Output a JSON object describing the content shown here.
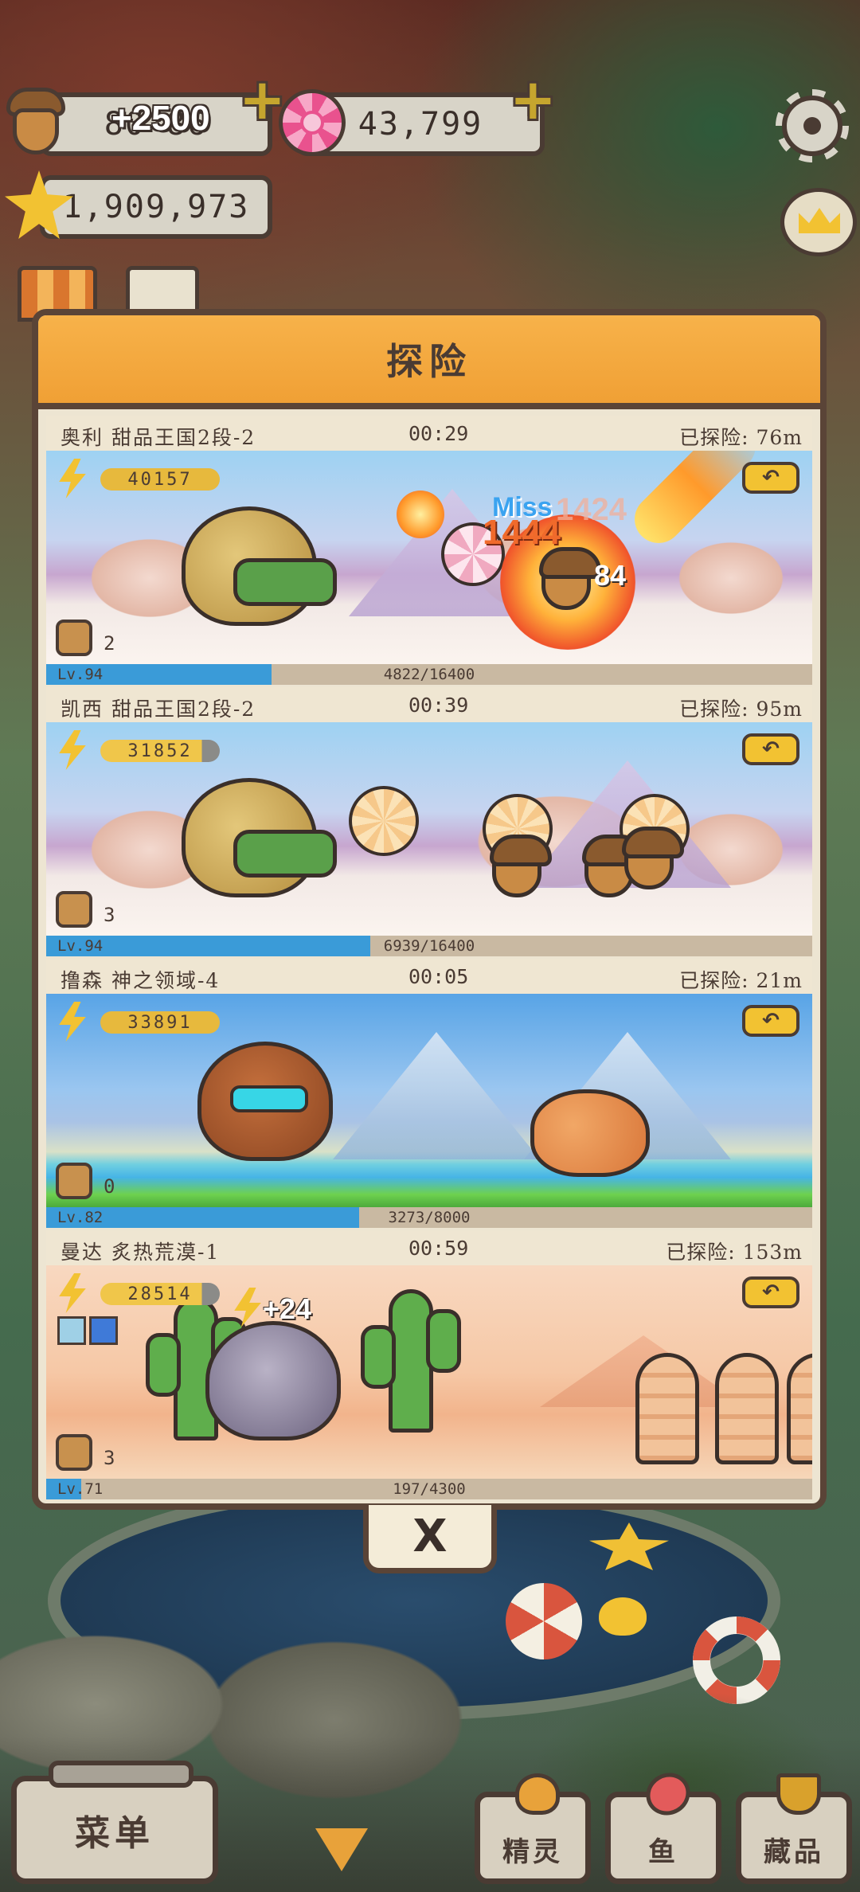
{
  "hud": {
    "acorn_value": "80  86",
    "acorn_gain": "+2500",
    "candy_value": "43,799",
    "star_value": "1,909,973",
    "plus_label": "+"
  },
  "panel": {
    "title": "探险"
  },
  "adventures": [
    {
      "name": "奥利  甜品王国2段-2",
      "time": "00:29",
      "distance": "已探险: 76m",
      "energy": "40157",
      "bag_count": "2",
      "level": "Lv.94",
      "xp_text": "4822/16400",
      "xp_fraction": 0.294,
      "damage": [
        "Miss",
        "1424",
        "1444",
        "84"
      ]
    },
    {
      "name": "凯西  甜品王国2段-2",
      "time": "00:39",
      "distance": "已探险: 95m",
      "energy": "31852",
      "bag_count": "3",
      "level": "Lv.94",
      "xp_text": "6939/16400",
      "xp_fraction": 0.423
    },
    {
      "name": "撸森  神之领域-4",
      "time": "00:05",
      "distance": "已探险: 21m",
      "energy": "33891",
      "bag_count": "0",
      "level": "Lv.82",
      "xp_text": "3273/8000",
      "xp_fraction": 0.409
    },
    {
      "name": "曼达  炙热荒漠-1",
      "time": "00:59",
      "distance": "已探险: 153m",
      "energy": "28514",
      "energy_gain": "+24",
      "bag_count": "3",
      "level": "Lv.71",
      "xp_text": "197/4300",
      "xp_fraction": 0.046
    }
  ],
  "close_label": "X",
  "return_icon": "↶",
  "bottom": {
    "menu": "菜单",
    "spirit": "精灵",
    "fish": "鱼",
    "collection": "藏品"
  },
  "colors": {
    "panel_header": "#f7b24a",
    "xp_bar": "#3a9bd8",
    "energy_pill": "#e7b93d",
    "outline": "#4a3b33"
  }
}
